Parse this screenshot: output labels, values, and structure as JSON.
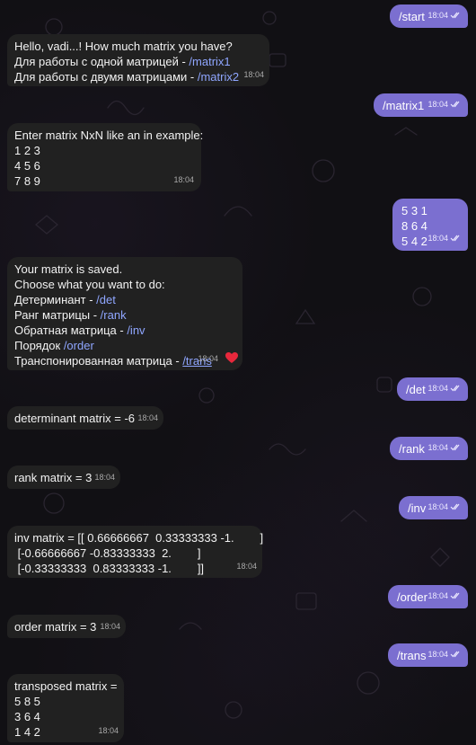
{
  "messages": [
    {
      "id": "m1",
      "dir": "out",
      "lines": [
        "/start"
      ],
      "time": "18:04"
    },
    {
      "id": "m2",
      "dir": "in",
      "lines": [
        {
          "text": "Hello, vadi...! How much matrix you have?"
        },
        {
          "text": "Для работы с одной матрицей - ",
          "cmd": "/matrix1"
        },
        {
          "text": "Для работы с двумя матрицами - ",
          "cmd": "/matrix2"
        }
      ],
      "time": "18:04"
    },
    {
      "id": "m3",
      "dir": "out",
      "lines": [
        "/matrix1"
      ],
      "time": "18:04"
    },
    {
      "id": "m4",
      "dir": "in",
      "lines": [
        {
          "text": "Enter matrix NxN like an in example:"
        },
        {
          "text": "1 2 3"
        },
        {
          "text": "4 5 6"
        },
        {
          "text": "7 8 9"
        }
      ],
      "time": "18:04"
    },
    {
      "id": "m5",
      "dir": "out",
      "lines": [
        "5 3 1",
        "8 6 4",
        "5 4 2"
      ],
      "time": "18:04"
    },
    {
      "id": "m6",
      "dir": "in",
      "lines": [
        {
          "text": "Your matrix is saved."
        },
        {
          "text": "Choose what you want to do:"
        },
        {
          "text": "Детерминант - ",
          "cmd": "/det"
        },
        {
          "text": "Ранг матрицы - ",
          "cmd": "/rank"
        },
        {
          "text": "Обратная матрица - ",
          "cmd": "/inv"
        },
        {
          "text": "Порядок ",
          "cmd": "/order"
        },
        {
          "text": "Транспонированная матрица - ",
          "cmd": "/trans",
          "underline": true
        }
      ],
      "time": "18:04",
      "reaction": "heart"
    },
    {
      "id": "m7",
      "dir": "out",
      "lines": [
        "/det"
      ],
      "time": "18:04"
    },
    {
      "id": "m8",
      "dir": "in",
      "lines": [
        {
          "text": "determinant matrix = -6"
        }
      ],
      "time": "18:04"
    },
    {
      "id": "m9",
      "dir": "out",
      "lines": [
        "/rank"
      ],
      "time": "18:04"
    },
    {
      "id": "m10",
      "dir": "in",
      "lines": [
        {
          "text": "rank matrix = 3"
        }
      ],
      "time": "18:04"
    },
    {
      "id": "m11",
      "dir": "out",
      "lines": [
        "/inv"
      ],
      "time": "18:04"
    },
    {
      "id": "m12",
      "dir": "in",
      "lines": [
        {
          "text": "inv matrix = [[ 0.66666667  0.33333333 -1.        ]"
        },
        {
          "text": " [-0.66666667 -0.83333333  2.        ]"
        },
        {
          "text": " [-0.33333333  0.83333333 -1.        ]]"
        }
      ],
      "time": "18:04"
    },
    {
      "id": "m13",
      "dir": "out",
      "lines": [
        "/order"
      ],
      "time": "18:04"
    },
    {
      "id": "m14",
      "dir": "in",
      "lines": [
        {
          "text": "order matrix = 3"
        }
      ],
      "time": "18:04"
    },
    {
      "id": "m15",
      "dir": "out",
      "lines": [
        "/trans"
      ],
      "time": "18:04"
    },
    {
      "id": "m16",
      "dir": "in",
      "lines": [
        {
          "text": "transposed matrix ="
        },
        {
          "text": "5 8 5"
        },
        {
          "text": "3 6 4"
        },
        {
          "text": "1 4 2"
        }
      ],
      "time": "18:04"
    }
  ],
  "colors": {
    "background": "#111014",
    "incoming_bubble": "#212121",
    "outgoing_bubble": "#7b6fd0",
    "link": "#8fa6ff",
    "reaction": "#e8283c"
  },
  "icons": {
    "read_receipt": "double-check-icon",
    "reaction": "heart-icon",
    "background": "doodle-pattern"
  }
}
